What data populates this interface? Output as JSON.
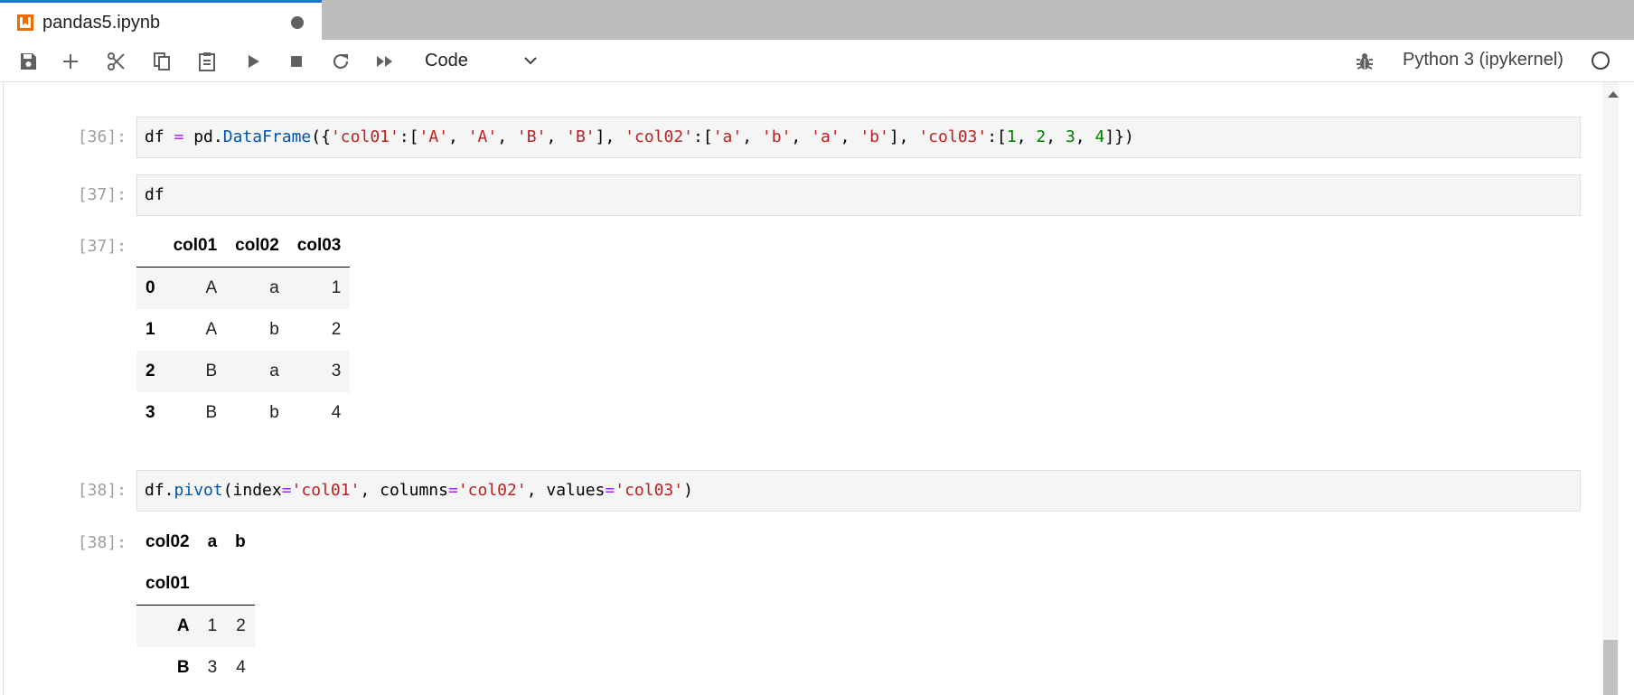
{
  "tab": {
    "title": "pandas5.ipynb"
  },
  "toolbar": {
    "cell_type": "Code",
    "kernel_name": "Python 3 (ipykernel)",
    "buttons": [
      "save-icon",
      "add-cell-icon",
      "cut-icon",
      "copy-icon",
      "paste-icon",
      "run-icon",
      "stop-icon",
      "restart-icon",
      "run-all-icon"
    ]
  },
  "cells": [
    {
      "prompt": "[36]:"
    },
    {
      "prompt": "[37]:",
      "code": "df",
      "out_prompt": "[37]:",
      "table": {
        "columns": [
          "col01",
          "col02",
          "col03"
        ],
        "rows": [
          {
            "index": "0",
            "values": [
              "A",
              "a",
              "1"
            ]
          },
          {
            "index": "1",
            "values": [
              "A",
              "b",
              "2"
            ]
          },
          {
            "index": "2",
            "values": [
              "B",
              "a",
              "3"
            ]
          },
          {
            "index": "3",
            "values": [
              "B",
              "b",
              "4"
            ]
          }
        ]
      }
    },
    {
      "prompt": "[38]:",
      "out_prompt": "[38]:",
      "table": {
        "columns_name": "col02",
        "columns": [
          "a",
          "b"
        ],
        "index_name": "col01",
        "rows": [
          {
            "index": "A",
            "values": [
              "1",
              "2"
            ]
          },
          {
            "index": "B",
            "values": [
              "3",
              "4"
            ]
          }
        ]
      }
    }
  ],
  "code": {
    "c36": [
      "df",
      " ",
      "=",
      " ",
      "pd.",
      "DataFrame",
      "({",
      "'col01'",
      ":[",
      "'A'",
      ", ",
      "'A'",
      ", ",
      "'B'",
      ", ",
      "'B'",
      "], ",
      "'col02'",
      ":[",
      "'a'",
      ", ",
      "'b'",
      ", ",
      "'a'",
      ", ",
      "'b'",
      "], ",
      "'col03'",
      ":[",
      "1",
      ", ",
      "2",
      ", ",
      "3",
      ", ",
      "4",
      "]})"
    ],
    "c38": [
      "df.",
      "pivot",
      "(index",
      "=",
      "'col01'",
      ", columns",
      "=",
      "'col02'",
      ", values",
      "=",
      "'col03'",
      ")"
    ]
  }
}
